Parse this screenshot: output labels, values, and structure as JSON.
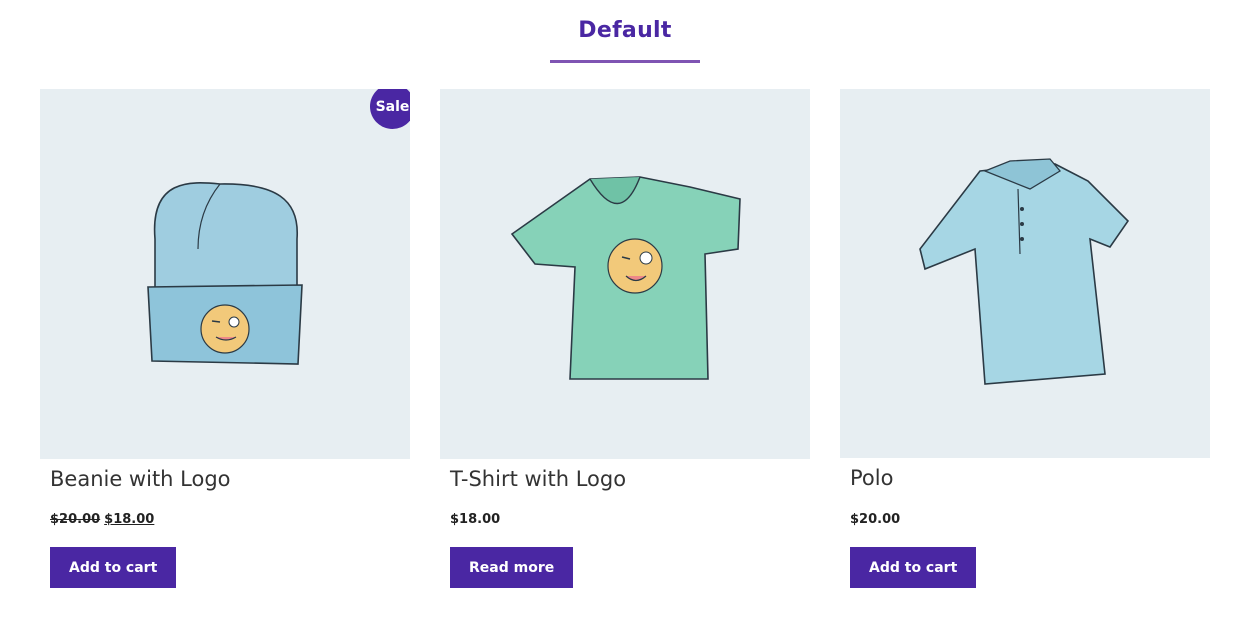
{
  "tab": {
    "title": "Default"
  },
  "products": [
    {
      "title": "Beanie with Logo",
      "badge": "Sale",
      "price_regular": "$20.00",
      "price_sale": "$18.00",
      "button": "Add to cart",
      "image": "beanie-icon"
    },
    {
      "title": "T-Shirt with Logo",
      "price": "$18.00",
      "button": "Read more",
      "image": "tshirt-icon"
    },
    {
      "title": "Polo",
      "price": "$20.00",
      "button": "Add to cart",
      "image": "polo-icon"
    }
  ],
  "colors": {
    "accent": "#4a27a3",
    "underline": "#7f54b3",
    "image_bg": "#e7eef2"
  }
}
